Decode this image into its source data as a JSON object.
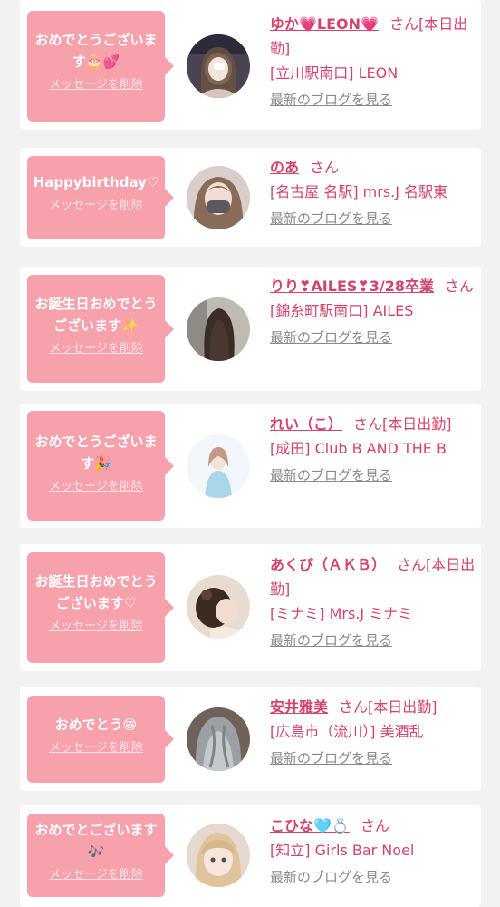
{
  "delete_label": "メッセージを削除",
  "blog_label": "最新のブログを見る",
  "san_label": "さん",
  "colors": {
    "bubble": "#f7a1ac",
    "name": "#d2446c",
    "blog": "#8a8a8a",
    "background": "#f2f2f2"
  },
  "items": [
    {
      "message": "おめでとうございます🎂💕",
      "name": "ゆか💗LEON💗",
      "status": "[本日出勤]",
      "shop": "[立川駅南口] LEON",
      "avatar_icon": "avatar-photo"
    },
    {
      "message": "Happybirthday♡",
      "name": "のあ",
      "status": "",
      "shop": "[名古屋 名駅] mrs.J 名駅東",
      "avatar_icon": "avatar-photo"
    },
    {
      "message": "お誕生日おめでとうございます✨",
      "name": "りり❣AILES❣3/28卒業",
      "status": "",
      "shop": "[錦糸町駅南口] AILES",
      "avatar_icon": "avatar-photo"
    },
    {
      "message": "おめでとうございます🎉",
      "name": "れい（こ）",
      "status": "[本日出勤]",
      "shop": "[成田] Club B AND THE B",
      "avatar_icon": "avatar-photo"
    },
    {
      "message": "お誕生日おめでとうございます♡",
      "name": "あくび（ＡＫＢ）",
      "status": "[本日出勤]",
      "shop": "[ミナミ] Mrs.J ミナミ",
      "avatar_icon": "avatar-photo"
    },
    {
      "message": "おめでとう😁",
      "name": "安井雅美",
      "status": "[本日出勤]",
      "shop": "[広島市（流川）] 美酒乱",
      "avatar_icon": "avatar-photo"
    },
    {
      "message": "おめでとございます🎶",
      "name": "こひな🩵💍",
      "status": "",
      "shop": "[知立] Girls Bar Noel",
      "avatar_icon": "avatar-photo"
    }
  ]
}
